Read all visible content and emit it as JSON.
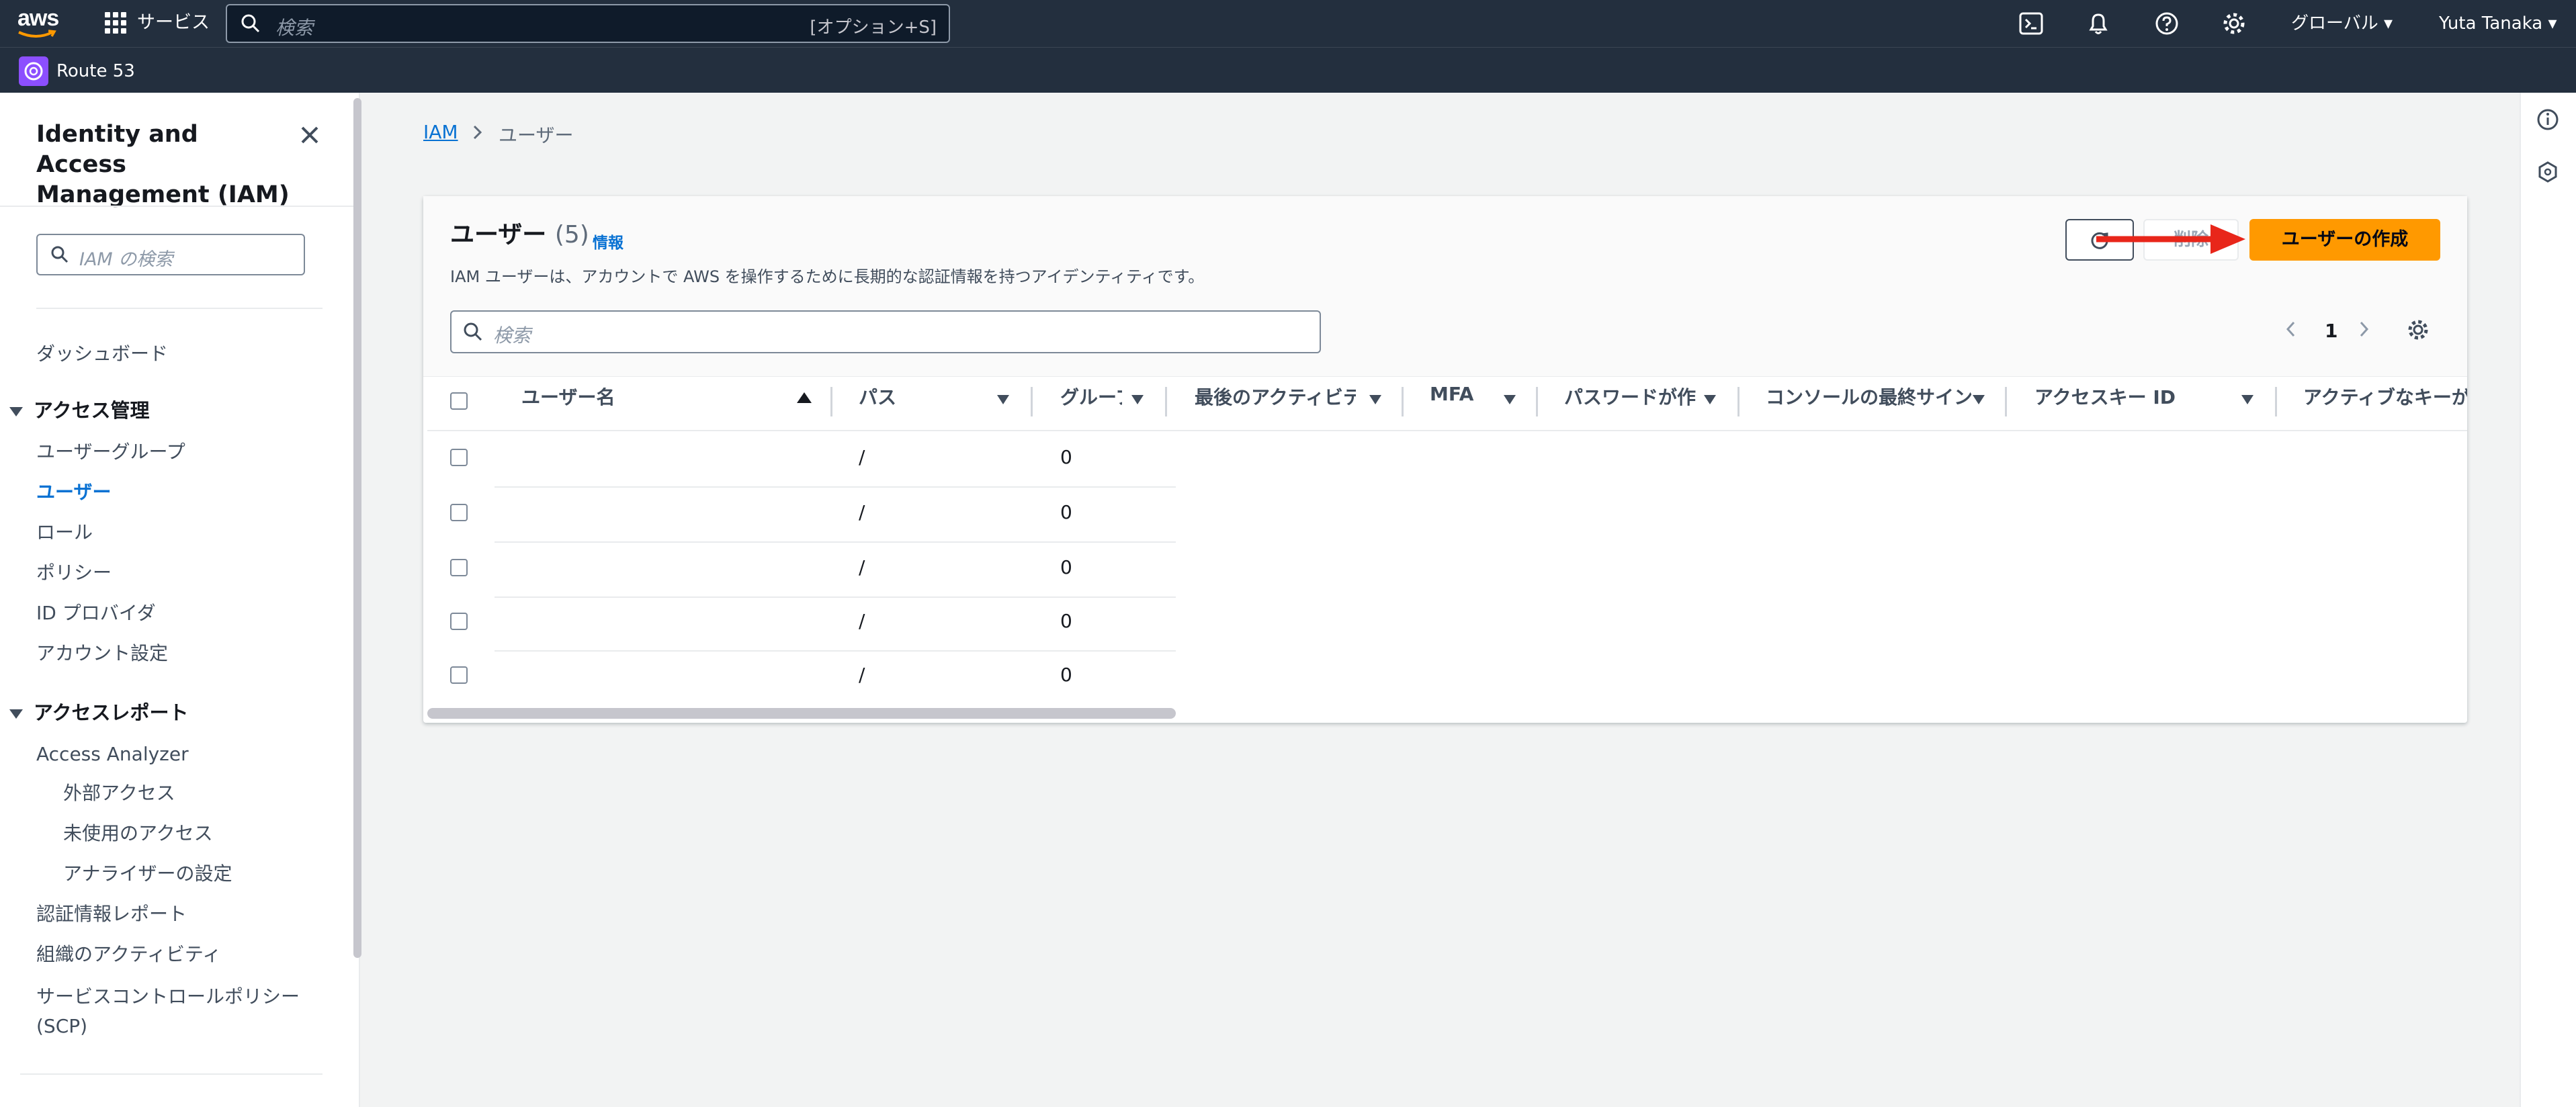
{
  "topbar": {
    "logo_text": "aws",
    "services_label": "サービス",
    "search_placeholder": "検索",
    "search_shortcut": "[オプション+S]",
    "region_label": "グローバル",
    "user_label": "Yuta Tanaka"
  },
  "subbar": {
    "service_label": "Route 53"
  },
  "sidebar": {
    "title": "Identity and Access Management (IAM)",
    "search_placeholder": "IAM の検索",
    "dashboard": "ダッシュボード",
    "section_access_mgmt": "アクセス管理",
    "access_items": [
      "ユーザーグループ",
      "ユーザー",
      "ロール",
      "ポリシー",
      "ID プロバイダ",
      "アカウント設定"
    ],
    "section_access_reports": "アクセスレポート",
    "access_analyzer": "Access Analyzer",
    "analyzer_items": [
      "外部アクセス",
      "未使用のアクセス",
      "アナライザーの設定"
    ],
    "report_items": [
      "認証情報レポート",
      "組織のアクティビティ",
      "サービスコントロールポリシー (SCP)"
    ]
  },
  "breadcrumb": {
    "root": "IAM",
    "current": "ユーザー"
  },
  "panel": {
    "title": "ユーザー",
    "count": "(5)",
    "info_link": "情報",
    "description": "IAM ユーザーは、アカウントで AWS を操作するために長期的な認証情報を持つアイデンティティです。",
    "delete_label": "削除",
    "create_label": "ユーザーの作成",
    "search_placeholder": "検索",
    "current_page": "1"
  },
  "table": {
    "columns": [
      "ユーザー名",
      "パス",
      "グループ",
      "最後のアクティビティ",
      "MFA",
      "パスワードが作成されてから",
      "コンソールの最終サインイン",
      "アクセスキー ID",
      "アクティブなキーが作成されてから"
    ],
    "rows": [
      {
        "path": "/",
        "groups": "0"
      },
      {
        "path": "/",
        "groups": "0"
      },
      {
        "path": "/",
        "groups": "0"
      },
      {
        "path": "/",
        "groups": "0"
      },
      {
        "path": "/",
        "groups": "0"
      }
    ]
  },
  "colors": {
    "topbar": "#232f3e",
    "link": "#0972d3",
    "primary_button": "#ff9900",
    "annotation_arrow": "#e8261a",
    "service_icon": "#8c4fff"
  }
}
